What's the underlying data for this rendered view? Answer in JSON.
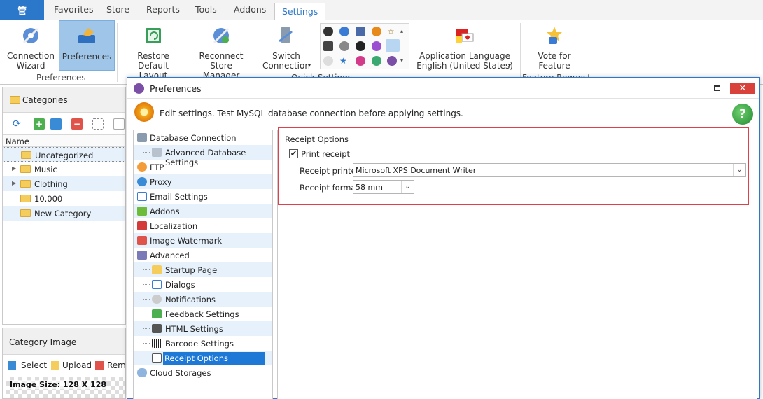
{
  "ribbon": {
    "app_label": "管",
    "tabs": [
      {
        "label": "Favorites"
      },
      {
        "label": "Store"
      },
      {
        "label": "Reports"
      },
      {
        "label": "Tools"
      },
      {
        "label": "Addons"
      },
      {
        "label": "Settings"
      }
    ],
    "active_tab": "Settings",
    "buttons": {
      "connection_wizard": "Connection Wizard",
      "preferences": "Preferences",
      "restore_layout": "Restore Default Layout",
      "reconnect": "Reconnect Store Manager",
      "switch_connection": "Switch Connection",
      "app_language": "Application Language",
      "app_language_value": "English (United States)",
      "vote": "Vote for Feature"
    },
    "groups": {
      "preferences": "Preferences",
      "quick_settings": "Quick Settings",
      "feature_request": "Feature Request"
    }
  },
  "categories": {
    "title": "Categories",
    "column": "Name",
    "items": [
      {
        "label": "Uncategorized"
      },
      {
        "label": "Music"
      },
      {
        "label": "Clothing"
      },
      {
        "label": "10.000"
      },
      {
        "label": "New Category"
      }
    ]
  },
  "category_image": {
    "title": "Category Image",
    "select": "Select",
    "upload": "Upload",
    "remove": "Remo",
    "image_size": "Image Size: 128 X 128"
  },
  "dialog": {
    "title": "Preferences",
    "info": "Edit settings. Test MySQL database connection before applying settings.",
    "nav": [
      {
        "label": "Database Connection",
        "child": false
      },
      {
        "label": "Advanced Database Settings",
        "child": true
      },
      {
        "label": "FTP",
        "child": false
      },
      {
        "label": "Proxy",
        "child": false
      },
      {
        "label": "Email Settings",
        "child": false
      },
      {
        "label": "Addons",
        "child": false
      },
      {
        "label": "Localization",
        "child": false
      },
      {
        "label": "Image Watermark",
        "child": false
      },
      {
        "label": "Advanced",
        "child": false
      },
      {
        "label": "Startup Page",
        "child": true
      },
      {
        "label": "Dialogs",
        "child": true
      },
      {
        "label": "Notifications",
        "child": true
      },
      {
        "label": "Feedback Settings",
        "child": true
      },
      {
        "label": "HTML Settings",
        "child": true
      },
      {
        "label": "Barcode Settings",
        "child": true
      },
      {
        "label": "Receipt Options",
        "child": true
      },
      {
        "label": "Cloud Storages",
        "child": false
      }
    ],
    "selected_nav": "Receipt Options",
    "receipt": {
      "group_title": "Receipt Options",
      "print_receipt_label": "Print receipt",
      "print_receipt_checked": "✔",
      "printer_label": "Receipt printer",
      "printer_value": "Microsoft XPS Document Writer",
      "format_label": "Receipt format",
      "format_value": "58 mm"
    }
  },
  "colors": {
    "accent": "#2b77c9",
    "selection": "#1e79d6",
    "highlight_border": "#e0404a",
    "close_button": "#d9413b"
  }
}
